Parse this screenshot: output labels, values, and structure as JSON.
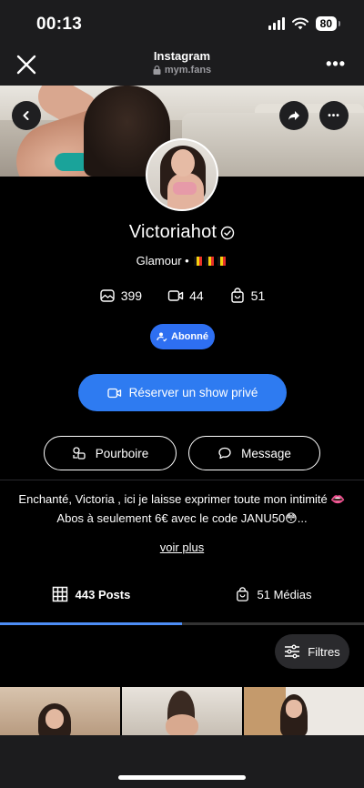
{
  "status_bar": {
    "time": "00:13",
    "battery": "80"
  },
  "browser": {
    "title": "Instagram",
    "url": "mym.fans"
  },
  "profile": {
    "name": "Victoriahot",
    "tagline": "Glamour •",
    "stats": [
      {
        "icon": "photo-stack-icon",
        "value": "399"
      },
      {
        "icon": "video-camera-icon",
        "value": "44"
      },
      {
        "icon": "shopping-bag-icon",
        "value": "51"
      }
    ],
    "subscribed_label": "Abonné",
    "reserve_label": "Réserver un show privé",
    "tip_label": "Pourboire",
    "message_label": "Message",
    "bio_line1": "Enchanté, Victoria , ici je laisse exprimer toute mon intimité 👄",
    "bio_line2": "Abos à seulement 6€ avec le code JANU50😳...",
    "see_more": "voir plus"
  },
  "tabs": [
    {
      "label": "443 Posts",
      "icon": "grid-icon",
      "active": true
    },
    {
      "label": "51 Médias",
      "icon": "shopping-bag-icon",
      "active": false
    }
  ],
  "tab_progress": 0.5,
  "filters_label": "Filtres",
  "colors": {
    "accent": "#2e7bf1",
    "background": "#000000",
    "chrome": "#1c1c1e"
  }
}
